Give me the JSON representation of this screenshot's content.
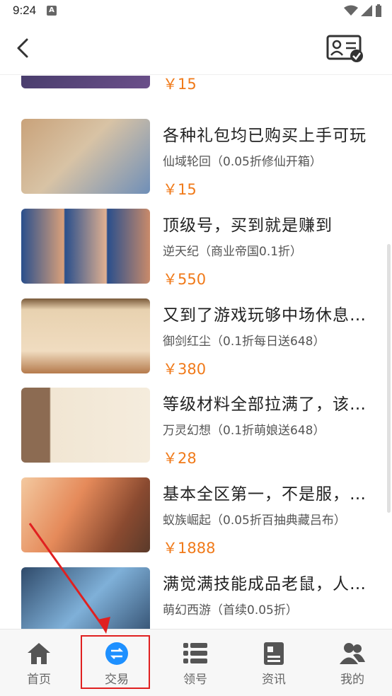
{
  "status_bar": {
    "time": "9:24",
    "notification_letter": "A"
  },
  "header": {
    "back_icon": "chevron-left-icon",
    "profile_icon": "id-card-check-icon"
  },
  "listings": [
    {
      "title": "",
      "subtitle": "",
      "price": "￥15",
      "thumb_colors": [
        "#3a3560",
        "#6b4f8a"
      ]
    },
    {
      "title": "各种礼包均已购买上手可玩",
      "subtitle": "仙域轮回（0.05折修仙开箱）",
      "price": "￥15",
      "thumb_colors": [
        "#c9a27a",
        "#6f8fb8"
      ]
    },
    {
      "title": "顶级号，买到就是赚到",
      "subtitle": "逆天纪（商业帝国0.1折）",
      "price": "￥550",
      "thumb_colors": [
        "#2a4f8c",
        "#d97a4a"
      ]
    },
    {
      "title": "又到了游戏玩够中场休息…",
      "subtitle": "御剑红尘（0.1折每日送648）",
      "price": "￥380",
      "thumb_colors": [
        "#e8d2b0",
        "#b57a4c"
      ]
    },
    {
      "title": "等级材料全部拉满了，该…",
      "subtitle": "万灵幻想（0.1折萌娘送648）",
      "price": "￥28",
      "thumb_colors": [
        "#f1e6d3",
        "#8c6b52"
      ]
    },
    {
      "title": "基本全区第一，不是服，…",
      "subtitle": "蚁族崛起（0.05折百抽典藏吕布）",
      "price": "￥1888",
      "thumb_colors": [
        "#e58a5a",
        "#5a3a2a"
      ]
    },
    {
      "title": "满觉满技能成品老鼠，人…",
      "subtitle": "萌幻西游（首续0.05折）",
      "price": "",
      "thumb_colors": [
        "#2f4a6a",
        "#7fb0d8"
      ]
    }
  ],
  "tabs": [
    {
      "label": "首页",
      "icon": "home-icon"
    },
    {
      "label": "交易",
      "icon": "exchange-icon"
    },
    {
      "label": "领号",
      "icon": "list-icon"
    },
    {
      "label": "资讯",
      "icon": "document-icon"
    },
    {
      "label": "我的",
      "icon": "users-icon"
    }
  ],
  "colors": {
    "price": "#f07a1a",
    "accent": "#1e90ff",
    "highlight": "#e02020"
  }
}
